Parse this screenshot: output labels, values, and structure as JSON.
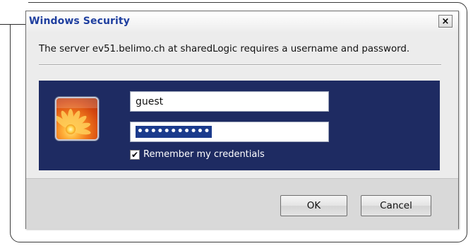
{
  "window": {
    "title": "Windows Security",
    "close_glyph": "×"
  },
  "prompt": {
    "message": "The server ev51.belimo.ch at sharedLogic requires a username and password."
  },
  "credentials": {
    "avatar_icon": "user-flower-avatar-icon",
    "username_value": "guest",
    "password_mask": "•••••••••••",
    "remember_checked": true,
    "remember_check_glyph": "✔",
    "remember_label": "Remember my credentials"
  },
  "buttons": {
    "ok_label": "OK",
    "cancel_label": "Cancel"
  },
  "colors": {
    "title_text": "#1f3f9f",
    "credential_panel": "#1e2b62",
    "selection_highlight": "#1b3b8c"
  }
}
